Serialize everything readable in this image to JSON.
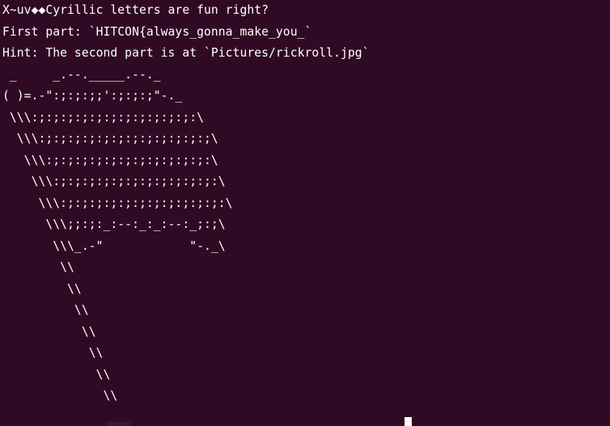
{
  "terminal": {
    "lines": [
      "X~uv◆◆Cyrillic letters are fun right?",
      "First part: `HITCON{always_gonna_make_you_`",
      "Hint: The second part is at `Pictures/rickroll.jpg`",
      " _     _.--._____.--._",
      "( )=.-\":;:;:;;':;:;:;\"-._",
      " \\\\\\:;:;:;:;:;:;:;:;:;:;:;:\\",
      "  \\\\\\:;:;:;:;:;:;:;:;:;:;:;:;\\",
      "   \\\\\\:;:;:;:;:;:;:;:;:;:;:;:\\",
      "    \\\\\\:;:;:;:;:;:;:;:;:;:;:;:\\",
      "     \\\\\\:;:;:;:;:;:;:;:;:;:;:;:\\",
      "      \\\\\\;;:;:_:--:_:_:--:_;:;\\",
      "       \\\\\\_.-\"            \"-._\\",
      "        \\\\",
      "         \\\\",
      "          \\\\",
      "           \\\\",
      "            \\\\",
      "             \\\\",
      "              \\\\"
    ]
  },
  "colors": {
    "background": "#300a24",
    "foreground": "#ffffff"
  }
}
